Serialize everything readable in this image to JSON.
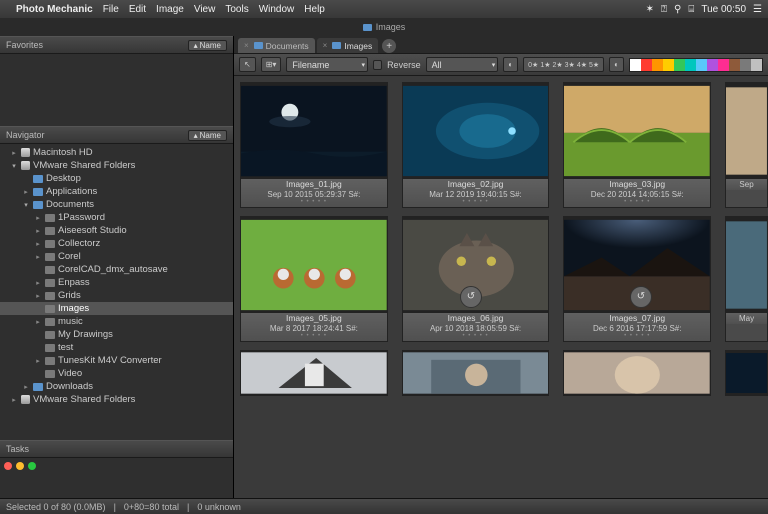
{
  "menubar": {
    "app": "Photo Mechanic",
    "items": [
      "File",
      "Edit",
      "Image",
      "View",
      "Tools",
      "Window",
      "Help"
    ],
    "time": "Tue 00:50"
  },
  "pathbar": {
    "folder": "Images"
  },
  "panels": {
    "favorites": "Favorites",
    "navigator": "Navigator",
    "tasks": "Tasks",
    "name_btn": "Name"
  },
  "tree": {
    "macintosh_hd": "Macintosh HD",
    "vmware": "VMware Shared Folders",
    "desktop": "Desktop",
    "applications": "Applications",
    "documents": "Documents",
    "pw": "1Password",
    "aiseesoft": "Aiseesoft Studio",
    "collectorz": "Collectorz",
    "corel": "Corel",
    "corelcad": "CorelCAD_dmx_autosave",
    "enpass": "Enpass",
    "grids": "Grids",
    "images": "Images",
    "music": "music",
    "mydrawings": "My Drawings",
    "test": "test",
    "tuneskit": "TunesKit M4V Converter",
    "video": "Video",
    "downloads": "Downloads",
    "vmware2": "VMware Shared Folders"
  },
  "tabs": {
    "documents": "Documents",
    "images": "Images"
  },
  "toolbar": {
    "sort": "Filename",
    "reverse": "Reverse",
    "filter": "All"
  },
  "colors": [
    "#ffffff",
    "#ff3b30",
    "#ff9500",
    "#ffcc00",
    "#34c759",
    "#00c7be",
    "#5ac8fa",
    "#af52de",
    "#ff2d92",
    "#8e5a3a",
    "#7a7a7a",
    "#c0c0c0"
  ],
  "images": [
    {
      "fn": "Images_01.jpg",
      "dt": "Sep 10 2015 05:29:37 S#:"
    },
    {
      "fn": "Images_02.jpg",
      "dt": "Mar 12 2019 19:40:15 S#:"
    },
    {
      "fn": "Images_03.jpg",
      "dt": "Dec 20 2014 14:05:15 S#:"
    },
    {
      "fn": "",
      "dt": "Sep"
    },
    {
      "fn": "Images_05.jpg",
      "dt": "Mar 8 2017 18:24:41 S#:"
    },
    {
      "fn": "Images_06.jpg",
      "dt": "Apr 10 2018 18:05:59 S#:"
    },
    {
      "fn": "Images_07.jpg",
      "dt": "Dec 6 2016 17:17:59 S#:"
    },
    {
      "fn": "",
      "dt": "May"
    }
  ],
  "status": {
    "selected": "Selected 0 of 80 (0.0MB)",
    "total": "0+80=80 total",
    "unknown": "0 unknown"
  }
}
